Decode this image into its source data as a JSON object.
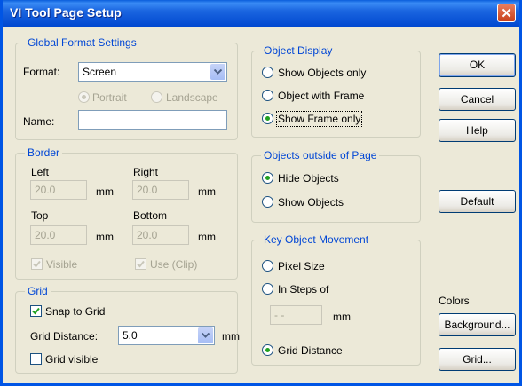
{
  "window": {
    "title": "VI Tool Page Setup",
    "close_glyph": "✕"
  },
  "global": {
    "legend": "Global Format Settings",
    "format_label": "Format:",
    "format_value": "Screen",
    "portrait": "Portrait",
    "landscape": "Landscape",
    "name_label": "Name:",
    "name_value": ""
  },
  "border": {
    "legend": "Border",
    "left_label": "Left",
    "left_value": "20.0",
    "right_label": "Right",
    "right_value": "20.0",
    "top_label": "Top",
    "top_value": "20.0",
    "bottom_label": "Bottom",
    "bottom_value": "20.0",
    "unit": "mm",
    "visible": "Visible",
    "use_clip": "Use (Clip)"
  },
  "grid": {
    "legend": "Grid",
    "snap": "Snap to Grid",
    "distance_label": "Grid Distance:",
    "distance_value": "5.0",
    "unit": "mm",
    "visible": "Grid visible"
  },
  "object_display": {
    "legend": "Object Display",
    "opt1": "Show Objects only",
    "opt2": "Object with Frame",
    "opt3": "Show Frame only"
  },
  "outside": {
    "legend": "Objects outside of Page",
    "opt1": "Hide Objects",
    "opt2": "Show Objects"
  },
  "movement": {
    "legend": "Key Object Movement",
    "opt1": "Pixel Size",
    "opt2": "In Steps of",
    "steps_value": "- -",
    "unit": "mm",
    "opt3": "Grid Distance"
  },
  "buttons": {
    "ok": "OK",
    "cancel": "Cancel",
    "help": "Help",
    "default": "Default",
    "colors_label": "Colors",
    "background": "Background...",
    "grid": "Grid..."
  },
  "colors": {
    "title_bar": "#0055e5",
    "legend_text": "#0046d5",
    "face": "#ece9d8",
    "radio_dot": "#21a121"
  }
}
